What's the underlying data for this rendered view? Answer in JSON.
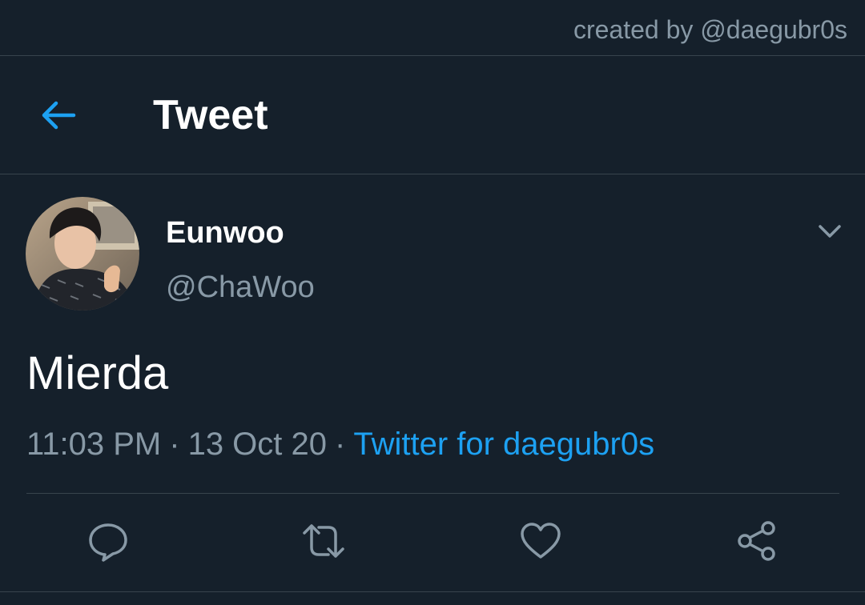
{
  "credit": {
    "text": "created by @daegubr0s"
  },
  "header": {
    "title": "Tweet"
  },
  "tweet": {
    "display_name": "Eunwoo",
    "handle": "@ChaWoo",
    "text": "Mierda",
    "time": "11:03 PM",
    "separator": "·",
    "date": "13 Oct 20",
    "source": "Twitter for daegubr0s"
  },
  "icons": {
    "back": "arrow-left-icon",
    "caret": "chevron-down-icon",
    "reply": "reply-icon",
    "retweet": "retweet-icon",
    "like": "heart-icon",
    "share": "share-icon"
  },
  "colors": {
    "background": "#15202b",
    "border": "#38444d",
    "secondary_text": "#8899a6",
    "accent": "#1da1f2"
  }
}
